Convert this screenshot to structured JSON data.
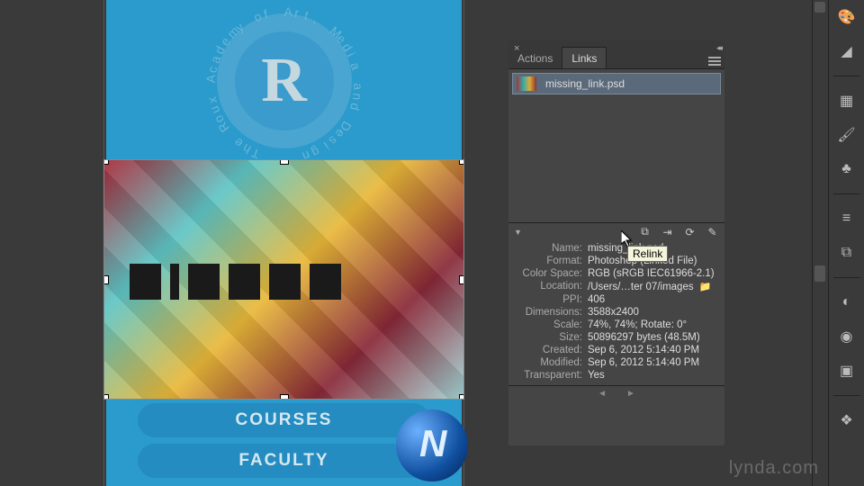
{
  "document": {
    "logo_letter": "R",
    "logo_ring_text": "The Roux Academy of Art, Media and Design",
    "buttons": {
      "courses": "COURSES",
      "faculty": "FACULTY"
    }
  },
  "panel": {
    "tabs": {
      "actions": "Actions",
      "links": "Links"
    },
    "links_list": [
      {
        "name": "missing_link.psd"
      }
    ],
    "action_icons": {
      "relink": "relink-icon",
      "goto": "goto-link-icon",
      "update": "update-link-icon",
      "edit": "edit-original-icon"
    },
    "info": {
      "name_label": "Name:",
      "name_value": "missing_link.psd",
      "format_label": "Format:",
      "format_value": "Photoshop (Linked File)",
      "colorspace_label": "Color Space:",
      "colorspace_value": "RGB (sRGB IEC61966-2.1)",
      "location_label": "Location:",
      "location_value": "/Users/…ter 07/images",
      "ppi_label": "PPI:",
      "ppi_value": "406",
      "dimensions_label": "Dimensions:",
      "dimensions_value": "3588x2400",
      "scale_label": "Scale:",
      "scale_value": "74%, 74%; Rotate: 0°",
      "size_label": "Size:",
      "size_value": "50896297 bytes (48.5M)",
      "created_label": "Created:",
      "created_value": "Sep 6, 2012 5:14:40 PM",
      "modified_label": "Modified:",
      "modified_value": "Sep 6, 2012 5:14:40 PM",
      "transparent_label": "Transparent:",
      "transparent_value": "Yes"
    }
  },
  "tooltip": {
    "relink": "Relink"
  },
  "watermark": "lynda.com"
}
